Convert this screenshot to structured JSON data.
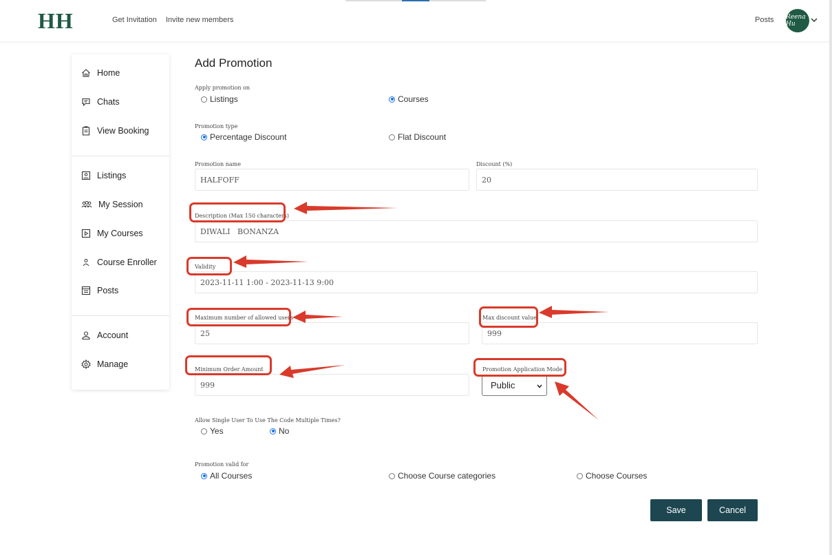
{
  "header": {
    "logo": "HH",
    "links": [
      "Get Invitation",
      "Invite new members"
    ],
    "posts": "Posts",
    "avatar_text": "Reena Hu"
  },
  "sidebar": {
    "items": [
      {
        "label": "Home",
        "icon": "home-icon"
      },
      {
        "label": "Chats",
        "icon": "chat-icon"
      },
      {
        "label": "View Booking",
        "icon": "clipboard-icon"
      },
      {
        "label": "Listings",
        "icon": "listing-icon"
      },
      {
        "label": "My Session",
        "icon": "group-icon"
      },
      {
        "label": "My Courses",
        "icon": "play-square-icon"
      },
      {
        "label": "Course Enroller",
        "icon": "user-icon"
      },
      {
        "label": "Posts",
        "icon": "posts-icon"
      },
      {
        "label": "Account",
        "icon": "account-icon"
      },
      {
        "label": "Manage",
        "icon": "gear-icon"
      }
    ]
  },
  "form": {
    "title": "Add Promotion",
    "apply_on": {
      "label": "Apply promotion on",
      "options": [
        "Listings",
        "Courses"
      ],
      "selected": "Courses"
    },
    "promo_type": {
      "label": "Promotion type",
      "options": [
        "Percentage Discount",
        "Flat Discount"
      ],
      "selected": "Percentage Discount"
    },
    "promo_name": {
      "label": "Promotion name",
      "value": "HALFOFF"
    },
    "discount": {
      "label": "Discount (%)",
      "value": "20"
    },
    "description": {
      "label": "Description (Max 150 characters)",
      "value": "DIWALI   BONANZA"
    },
    "validity": {
      "label": "Validity",
      "value": "2023-11-11 1:00 - 2023-11-13 9:00"
    },
    "max_users": {
      "label": "Maximum number of allowed users",
      "value": "25"
    },
    "max_discount": {
      "label": "Max discount value",
      "value": "999"
    },
    "min_order": {
      "label": "Minimum Order Amount",
      "value": "999"
    },
    "app_mode": {
      "label": "Promotion Application Mode",
      "value": "Public"
    },
    "multi_use": {
      "label": "Allow Single User To Use The Code Multiple Times?",
      "options": [
        "Yes",
        "No"
      ],
      "selected": "No"
    },
    "valid_for": {
      "label": "Promotion valid for",
      "options": [
        "All Courses",
        "Choose Course categories",
        "Choose Courses"
      ],
      "selected": "All Courses"
    },
    "save_label": "Save",
    "cancel_label": "Cancel"
  },
  "colors": {
    "brand": "#1f5a45",
    "button": "#1d4650",
    "annotation": "#d93a2b",
    "radio_on": "#1a73e8"
  }
}
